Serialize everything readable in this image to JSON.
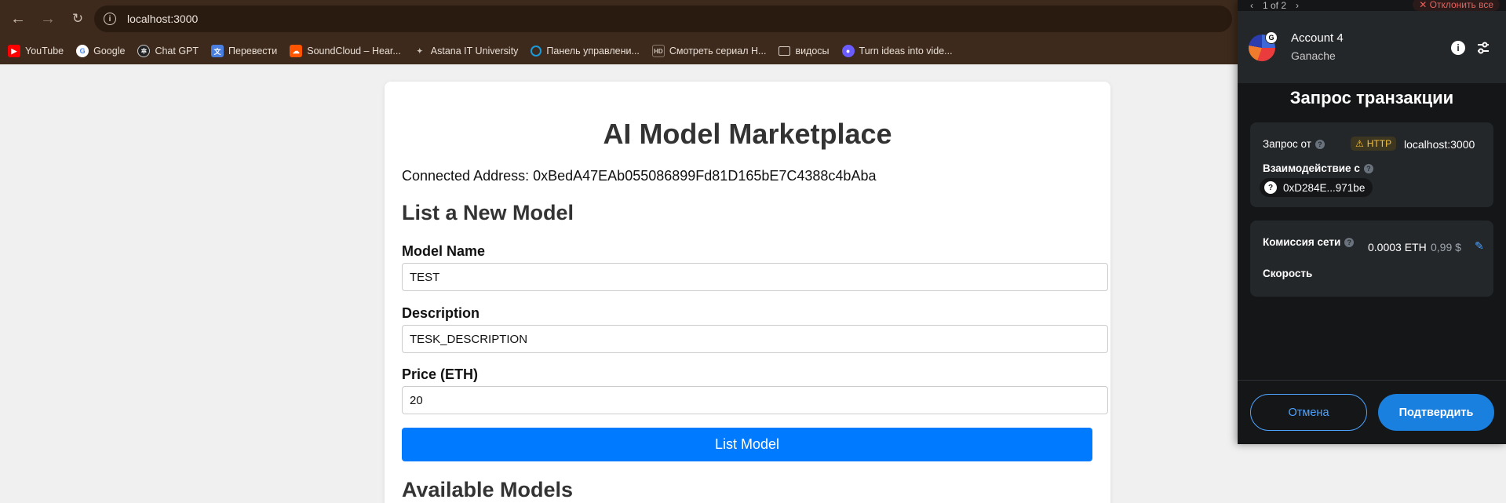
{
  "browser": {
    "url": "localhost:3000",
    "bookmarks": [
      {
        "label": "YouTube",
        "icon": "youtube-icon",
        "color": "#ff0000"
      },
      {
        "label": "Google",
        "icon": "google-icon",
        "color": "#4285f4"
      },
      {
        "label": "Chat GPT",
        "icon": "chatgpt-icon",
        "color": "#222222"
      },
      {
        "label": "Перевести",
        "icon": "translate-icon",
        "color": "#4a7fe0"
      },
      {
        "label": "SoundCloud – Hear...",
        "icon": "soundcloud-icon",
        "color": "#ff5500"
      },
      {
        "label": "Astana IT University",
        "icon": "astana-it-icon",
        "color": "#7a6a5e"
      },
      {
        "label": "Панель управлени...",
        "icon": "control-panel-icon",
        "color": "#1a9ad9"
      },
      {
        "label": "Смотреть сериал Н...",
        "icon": "hd-icon",
        "color": "#7a6a5e"
      },
      {
        "label": "видосы",
        "icon": "folder-icon",
        "color": "#3d2a1c"
      },
      {
        "label": "Turn ideas into vide...",
        "icon": "video-ai-icon",
        "color": "#6a5cff"
      }
    ]
  },
  "page": {
    "title": "AI Model Marketplace",
    "connected_address": "Connected Address: 0xBedA47EAb055086899Fd81D165bE7C4388c4bAba",
    "list_section_title": "List a New Model",
    "model_name_label": "Model Name",
    "model_name_value": "TEST",
    "description_label": "Description",
    "description_value": "TESK_DESCRIPTION",
    "price_label": "Price (ETH)",
    "price_value": "20",
    "list_button": "List Model",
    "available_title": "Available Models"
  },
  "wallet": {
    "pager": "1 of 2",
    "reject_all": "✕ Отклонить все",
    "account_name": "Account 4",
    "network": "Ganache",
    "avatar_badge": "G",
    "title": "Запрос транзакции",
    "request_from_label": "Запрос от",
    "http_badge": "HTTP",
    "origin": "localhost:3000",
    "interact_label": "Взаимодействие с",
    "contract_address": "0xD284E...971be",
    "network_fee_label": "Комиссия сети",
    "fee_eth": "0.0003 ETH",
    "fee_fiat": "0,99 $",
    "speed_label": "Скорость",
    "cancel_button": "Отмена",
    "confirm_button": "Подтвердить"
  }
}
